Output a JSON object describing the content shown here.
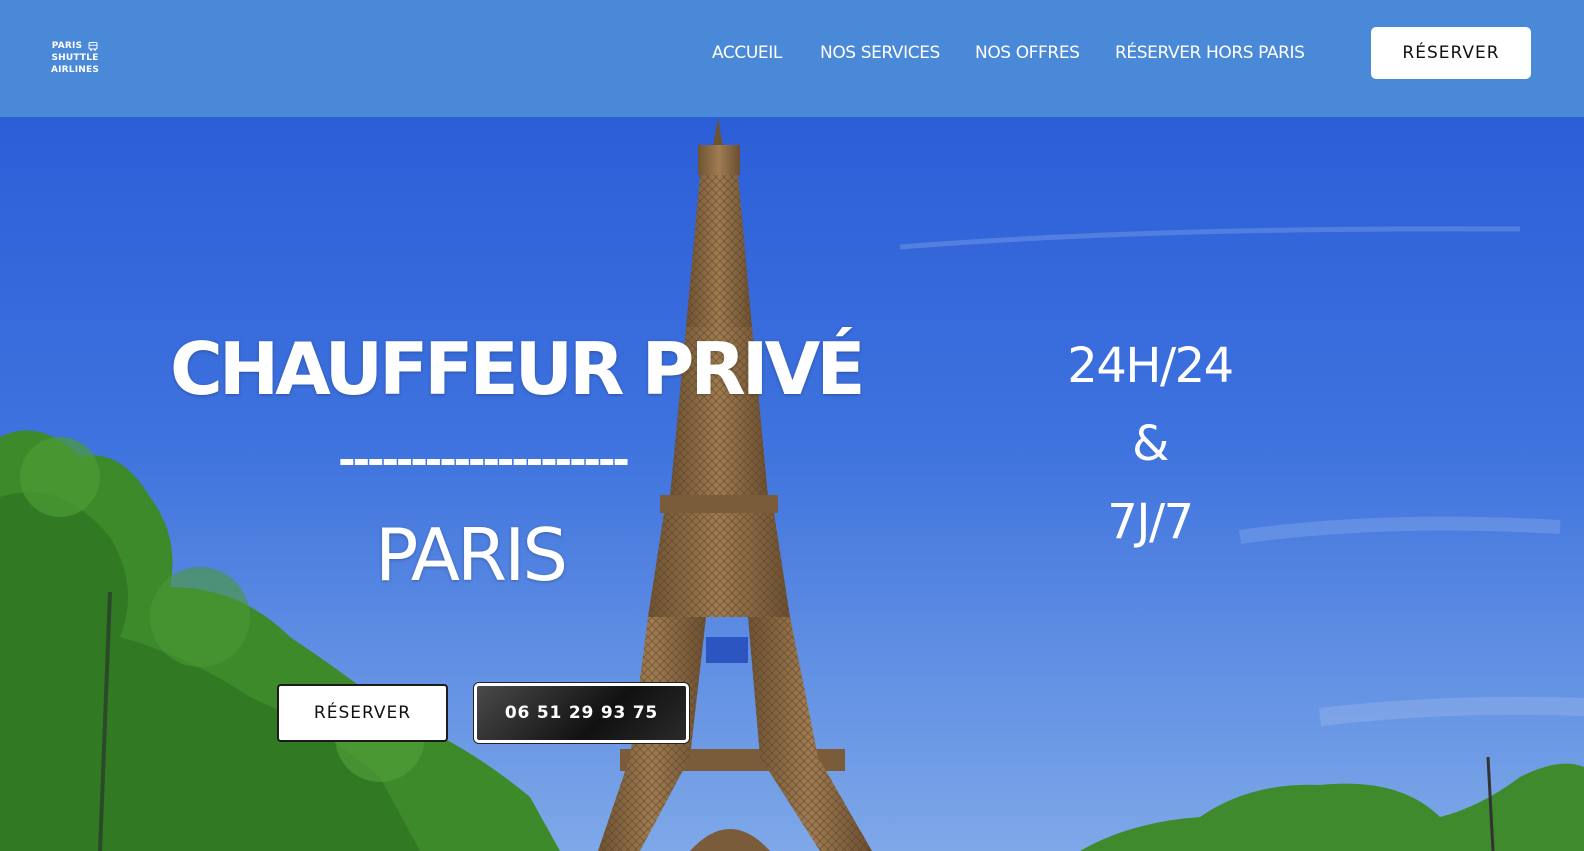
{
  "brand": {
    "logo_line1": "PARIS",
    "logo_line2": "SHUTTLE AIRLINES",
    "logo_icon": "bus-icon"
  },
  "nav": {
    "items": [
      {
        "label": "ACCUEIL"
      },
      {
        "label": "NOS SERVICES"
      },
      {
        "label": "NOS OFFRES"
      },
      {
        "label": "RÉSERVER HORS PARIS"
      }
    ],
    "cta_label": "RÉSERVER"
  },
  "hero": {
    "title": "CHAUFFEUR PRIVÉ",
    "divider": "--------------------",
    "city": "PARIS",
    "hours_line1": "24H/24",
    "hours_line2": "&",
    "hours_line3": "7J/7",
    "reserve_label": "RÉSERVER",
    "phone_label": "06 51 29 93 75"
  },
  "colors": {
    "header_bg": "#4a88d8",
    "sky": "#3b6fdd",
    "tower": "#8a6a43",
    "foliage": "#3f8a2c"
  }
}
